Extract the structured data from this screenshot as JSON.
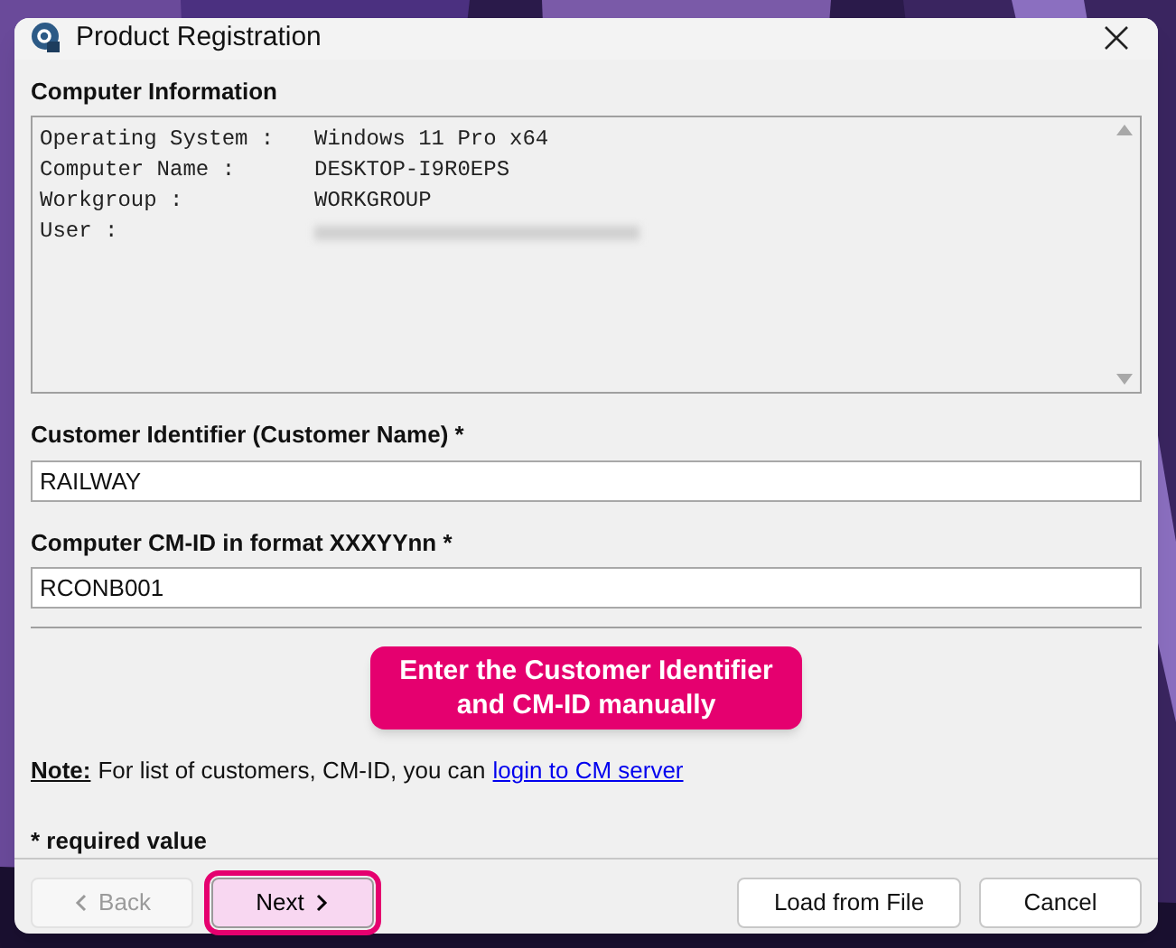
{
  "window": {
    "title": "Product Registration"
  },
  "computer_info": {
    "heading": "Computer Information",
    "lines": [
      {
        "label": "Operating System :",
        "value": "Windows 11 Pro x64",
        "redacted": false
      },
      {
        "label": "Computer Name :",
        "value": "DESKTOP-I9R0EPS",
        "redacted": false
      },
      {
        "label": "Workgroup :",
        "value": "WORKGROUP",
        "redacted": false
      },
      {
        "label": "User :",
        "redacted": true
      }
    ]
  },
  "fields": [
    {
      "label": "Customer Identifier (Customer Name) *",
      "value": "RAILWAY"
    },
    {
      "label": "Computer CM-ID in format XXXYYnn *",
      "value": "RCONB001"
    }
  ],
  "callout": {
    "lines": [
      "Enter the Customer Identifier",
      "and CM-ID manually"
    ]
  },
  "note": {
    "label": "Note:",
    "text": "For list of customers, CM-ID, you can",
    "link": "login to CM server"
  },
  "required_hint": "* required value",
  "buttons": [
    {
      "label": "Back",
      "kind": "back",
      "disabled": true,
      "highlighted": false
    },
    {
      "label": "Next",
      "kind": "next",
      "disabled": false,
      "highlighted": true
    },
    {
      "label": "Load from File",
      "kind": "plain",
      "disabled": false,
      "highlighted": false
    },
    {
      "label": "Cancel",
      "kind": "plain",
      "disabled": false,
      "highlighted": false
    }
  ]
}
